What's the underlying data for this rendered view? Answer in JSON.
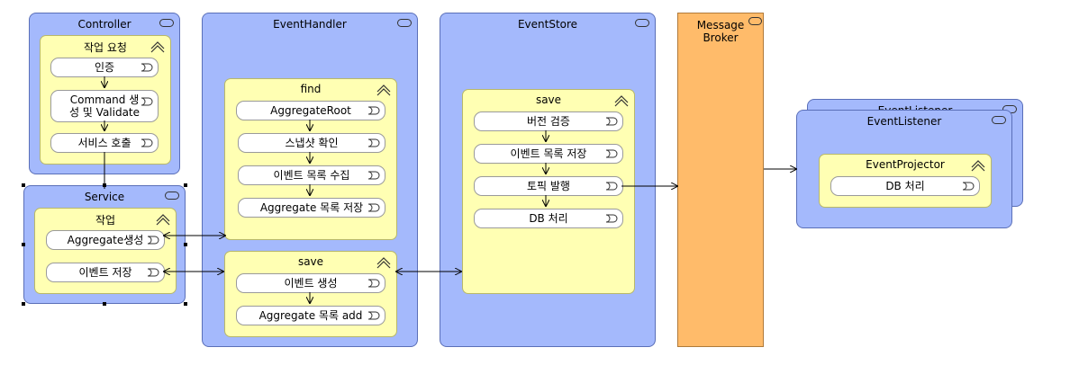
{
  "controller": {
    "title": "Controller",
    "group": {
      "title": "작업 요청",
      "steps": [
        "인증",
        "Command 생\n성 및 Validate",
        "서비스 호출"
      ]
    }
  },
  "service": {
    "title": "Service",
    "group": {
      "title": "작업",
      "steps": [
        "Aggregate생성",
        "이벤트 저장"
      ]
    }
  },
  "event_handler": {
    "title": "EventHandler",
    "find": {
      "title": "find",
      "steps": [
        "AggregateRoot",
        "스냅샷 확인",
        "이벤트 목록 수집",
        "Aggregate 목록 저장"
      ]
    },
    "save": {
      "title": "save",
      "steps": [
        "이벤트 생성",
        "Aggregate 목록 add"
      ]
    }
  },
  "event_store": {
    "title": "EventStore",
    "save": {
      "title": "save",
      "steps": [
        "버전 검증",
        "이벤트 목록 저장",
        "토픽 발행",
        "DB 처리"
      ]
    }
  },
  "broker": {
    "title": "Message\nBroker"
  },
  "event_listener": {
    "back_title": "EventListener",
    "title": "EventListener",
    "projector": {
      "title": "EventProjector",
      "steps": [
        "DB 처리"
      ]
    }
  }
}
